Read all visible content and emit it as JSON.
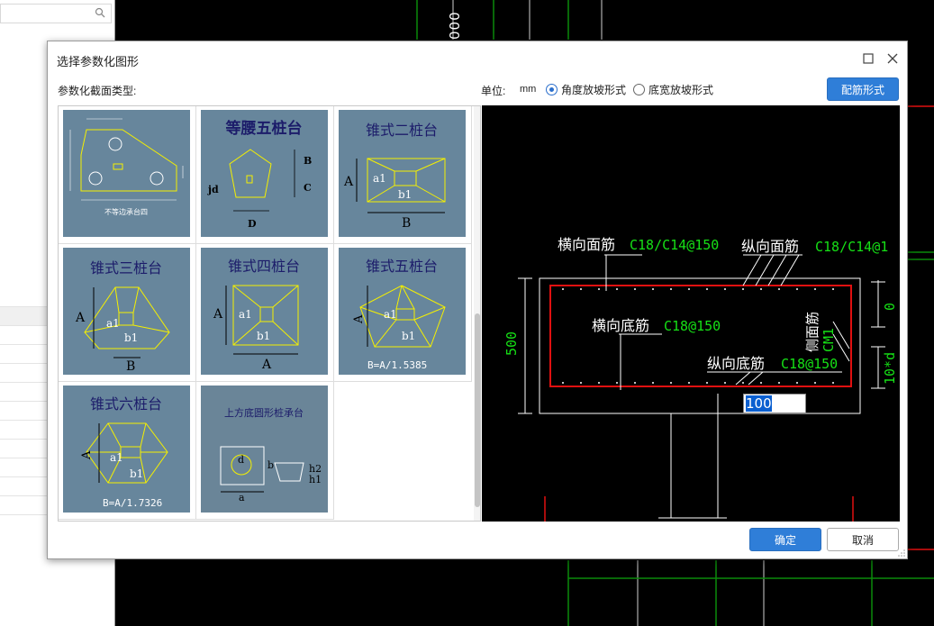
{
  "background": {
    "cad_dim_text": "000"
  },
  "dialog": {
    "title": "选择参数化图形",
    "section_label": "参数化截面类型:",
    "unit_label": "单位:",
    "unit_value": "mm",
    "radio_angle": "角度放坡形式",
    "radio_width": "底宽放坡形式",
    "radio_selected": "角度放坡形式",
    "rebar_button": "配筋形式",
    "ok_button": "确定",
    "cancel_button": "取消"
  },
  "tiles": [
    {
      "caption": "不等边承台四"
    },
    {
      "caption": "等腰五桩台"
    },
    {
      "caption": "锥式二桩台"
    },
    {
      "caption": "锥式三桩台"
    },
    {
      "caption": "锥式四桩台"
    },
    {
      "caption": "锥式五桩台",
      "note": "B=A/1.5385"
    },
    {
      "caption": "锥式六桩台",
      "note": "B=A/1.7326"
    },
    {
      "caption": "上方底圆形桩承台"
    }
  ],
  "tile_labels": {
    "a1": "a1",
    "b1": "b1",
    "A": "A",
    "B": "B",
    "C": "C",
    "D": "D",
    "jd": "jd",
    "a": "a",
    "b": "b",
    "d": "d",
    "h1": "h1",
    "h2": "h2"
  },
  "preview": {
    "top_transverse_label": "横向面筋",
    "top_transverse_value": "C18/C14@150",
    "top_longitudinal_label": "纵向面筋",
    "top_longitudinal_value": "C18/C14@1",
    "bottom_transverse_label": "横向底筋",
    "bottom_transverse_value": "C18@150",
    "bottom_longitudinal_label": "纵向底筋",
    "bottom_longitudinal_value": "C18@150",
    "side_label": "侧面筋",
    "side_value": "CM1",
    "height_dim": "500",
    "top_dim": "0",
    "side_dim": "10*d",
    "input_value": "100"
  }
}
